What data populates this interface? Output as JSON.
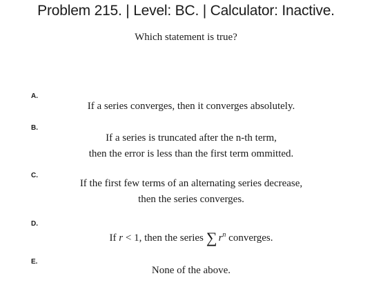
{
  "header": {
    "title": "Problem 215. | Level: BC. | Calculator: Inactive."
  },
  "question": "Which statement is true?",
  "choices": [
    {
      "letter": "A.",
      "lines": [
        "If a series converges, then it converges absolutely."
      ]
    },
    {
      "letter": "B.",
      "lines": [
        "If a series is truncated after the n-th term,",
        "then the error is less than the first term ommitted."
      ]
    },
    {
      "letter": "C.",
      "lines": [
        "If the first few terms of an alternating series decrease,",
        "then the series converges."
      ]
    },
    {
      "letter": "D.",
      "math": {
        "prefix": "If",
        "variable": "r",
        "relation": "< 1, then the series",
        "sum_symbol": "∑",
        "term_base": "r",
        "term_exponent": "n",
        "suffix": "converges."
      }
    },
    {
      "letter": "E.",
      "lines": [
        "None of the above."
      ]
    }
  ]
}
